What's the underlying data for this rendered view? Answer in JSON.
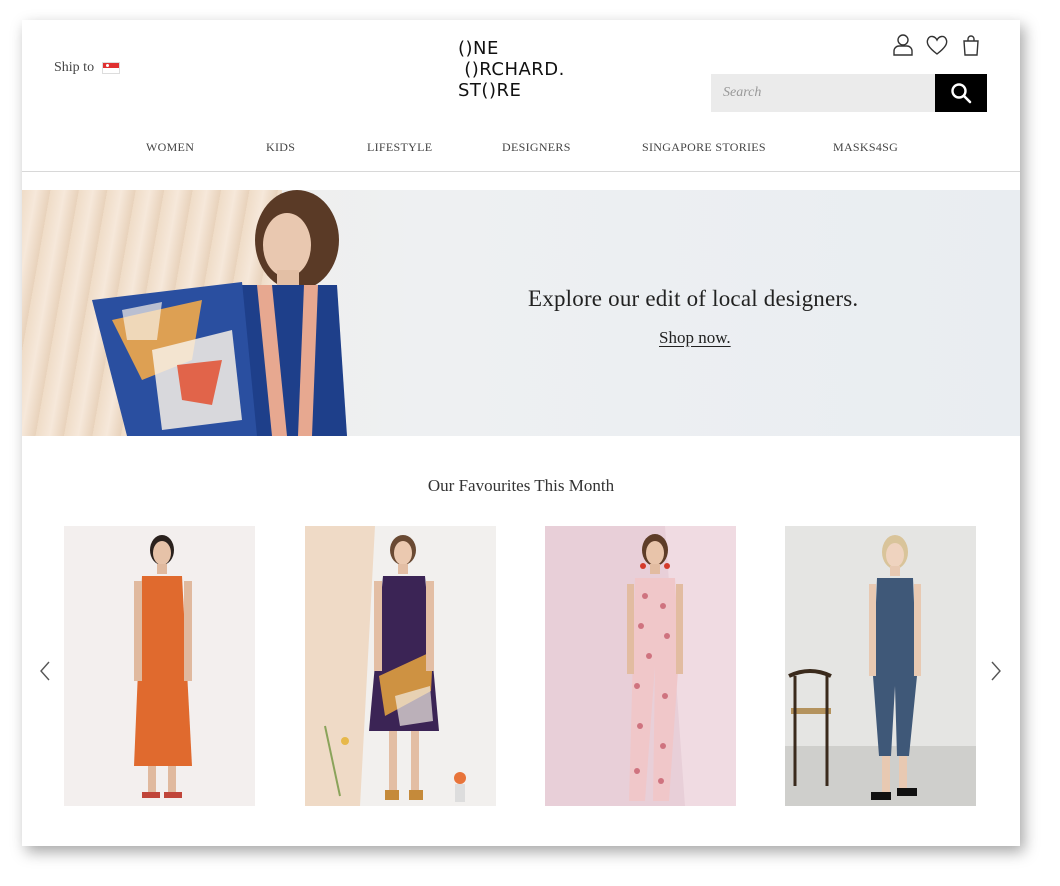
{
  "header": {
    "ship_to_label": "Ship to",
    "flag_icon": "singapore-flag-icon",
    "logo_lines": [
      "()NE",
      " ()RCHARD.",
      "ST()RE"
    ],
    "icons": [
      "user-icon",
      "heart-icon",
      "shopping-bag-icon"
    ],
    "search": {
      "placeholder": "Search",
      "value": "",
      "button_icon": "search-icon"
    }
  },
  "nav": {
    "items": [
      "WOMEN",
      "KIDS",
      "LIFESTYLE",
      "DESIGNERS",
      "SINGAPORE STORIES",
      "MASKS4SG"
    ]
  },
  "hero": {
    "headline": "Explore our edit of local designers.",
    "cta": "Shop now."
  },
  "favourites": {
    "title": "Our Favourites This Month",
    "products": [
      {
        "image": "model-in-orange-sleeveless-maxi-dress"
      },
      {
        "image": "model-in-purple-printed-sleeveless-dress"
      },
      {
        "image": "model-in-pink-floral-jumpsuit"
      },
      {
        "image": "model-in-denim-jumpsuit"
      }
    ],
    "prev_icon": "chevron-left-icon",
    "next_icon": "chevron-right-icon"
  },
  "colors": {
    "accent": "#000000",
    "search_bg": "#ebebeb"
  }
}
